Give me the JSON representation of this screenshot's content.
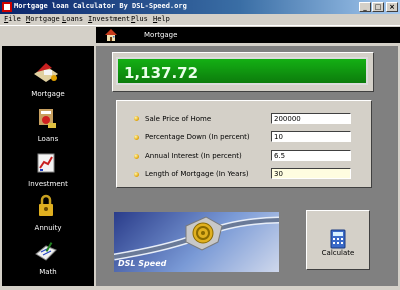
{
  "window": {
    "title": "Mortgage loan Calculator By DSL-Speed.org"
  },
  "title_buttons": {
    "minimize": "_",
    "maximize": "□",
    "close": "×"
  },
  "menu": [
    "File",
    "Mortgage",
    "Loans",
    "Investment",
    "Plus",
    "Help"
  ],
  "header": {
    "title": "Mortgage"
  },
  "sidebar": [
    {
      "label": "Mortgage",
      "icon": "mortgage-icon"
    },
    {
      "label": "Loans",
      "icon": "loans-icon"
    },
    {
      "label": "Investment",
      "icon": "investment-icon"
    },
    {
      "label": "Annuity",
      "icon": "annuity-icon"
    },
    {
      "label": "Math",
      "icon": "math-icon"
    }
  ],
  "result": {
    "value": "1,137.72"
  },
  "fields": [
    {
      "label": "Sale Price of Home",
      "value": "200000"
    },
    {
      "label": "Percentage Down (In percent)",
      "value": "10"
    },
    {
      "label": "Annual Interest (In percent)",
      "value": "6.5"
    },
    {
      "label": "Length of Mortgage (In Years)",
      "value": "30"
    }
  ],
  "banner": {
    "text": "DSL Speed"
  },
  "calculate": {
    "label": "Calculate"
  },
  "colors": {
    "display": "#0c8c0c",
    "sidebar": "#000000",
    "content": "#808080"
  }
}
